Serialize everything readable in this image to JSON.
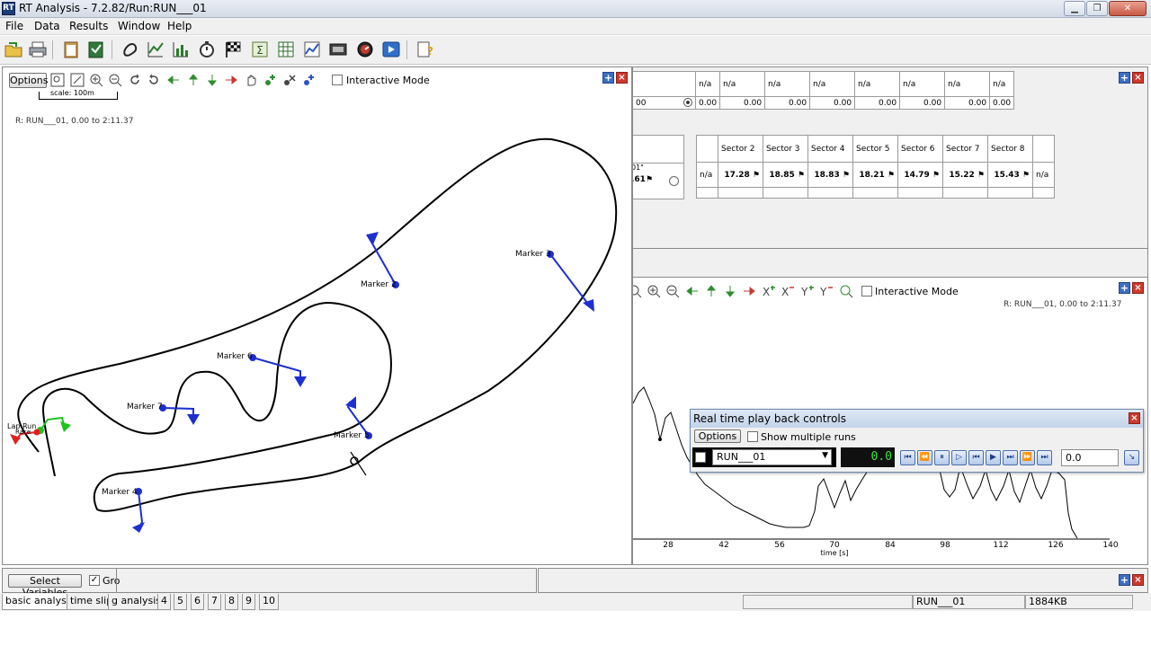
{
  "window": {
    "title": "RT Analysis - 7.2.82/Run:RUN___01",
    "icon_text": "RT"
  },
  "menu": [
    "File",
    "Data",
    "Results",
    "Window",
    "Help"
  ],
  "map_panel": {
    "options_label": "Options",
    "interactive_label": "Interactive Mode",
    "scale_label": "scale: 100m",
    "run_label": "R:  RUN___01, 0.00 to 2:11.37",
    "markers": [
      {
        "label": "Marker 2"
      },
      {
        "label": "Marker 3"
      },
      {
        "label": "Marker 6"
      },
      {
        "label": "Marker 7"
      },
      {
        "label": "Marker 5"
      },
      {
        "label": "Marker 4"
      }
    ],
    "start_label": "Lap Run",
    "start_label_small": "Race"
  },
  "results_table": {
    "row1_values": [
      "n/a",
      "n/a",
      "n/a",
      "n/a",
      "n/a",
      "n/a",
      "n/a",
      "n/a"
    ],
    "row2_first": "00",
    "row2_values": [
      "0.00",
      "0.00",
      "0.00",
      "0.00",
      "0.00",
      "0.00",
      "0.00",
      "0.00"
    ],
    "sector_headers": [
      "Sector 2",
      "Sector 3",
      "Sector 4",
      "Sector 5",
      "Sector 6",
      "Sector 7",
      "Sector 8"
    ],
    "left_partial": ".61",
    "left_partial_quote": "01\"",
    "na": "n/a",
    "sector_values": [
      "17.28",
      "18.85",
      "18.83",
      "18.21",
      "14.79",
      "15.22",
      "15.43"
    ],
    "tail_na": "n/a"
  },
  "graph_panel": {
    "interactive_label": "Interactive Mode",
    "run_label": "R:  RUN___01, 0.00 to 2:11.37",
    "x_ticks": [
      "28",
      "42",
      "56",
      "70",
      "84",
      "98",
      "112",
      "126",
      "140"
    ],
    "x_axis_label": "time [s]"
  },
  "playback": {
    "title": "Real time play back controls",
    "options_label": "Options",
    "show_multiple_label": "Show multiple runs",
    "run_select": "RUN___01",
    "lcd_value": "0.0",
    "speed_value": "0.0"
  },
  "bottom": {
    "select_variables_label": "Select Variables",
    "gro_label": "Gro"
  },
  "tabs": [
    "basic analysis",
    "time slip",
    "g analysis",
    "4",
    "5",
    "6",
    "7",
    "8",
    "9",
    "10"
  ],
  "status": {
    "run": "RUN___01",
    "memory": "1884KB"
  },
  "colors": {
    "marker_blue": "#1c2fd0",
    "track": "#000000",
    "start_green": "#1fc21f",
    "start_red": "#e02020"
  }
}
